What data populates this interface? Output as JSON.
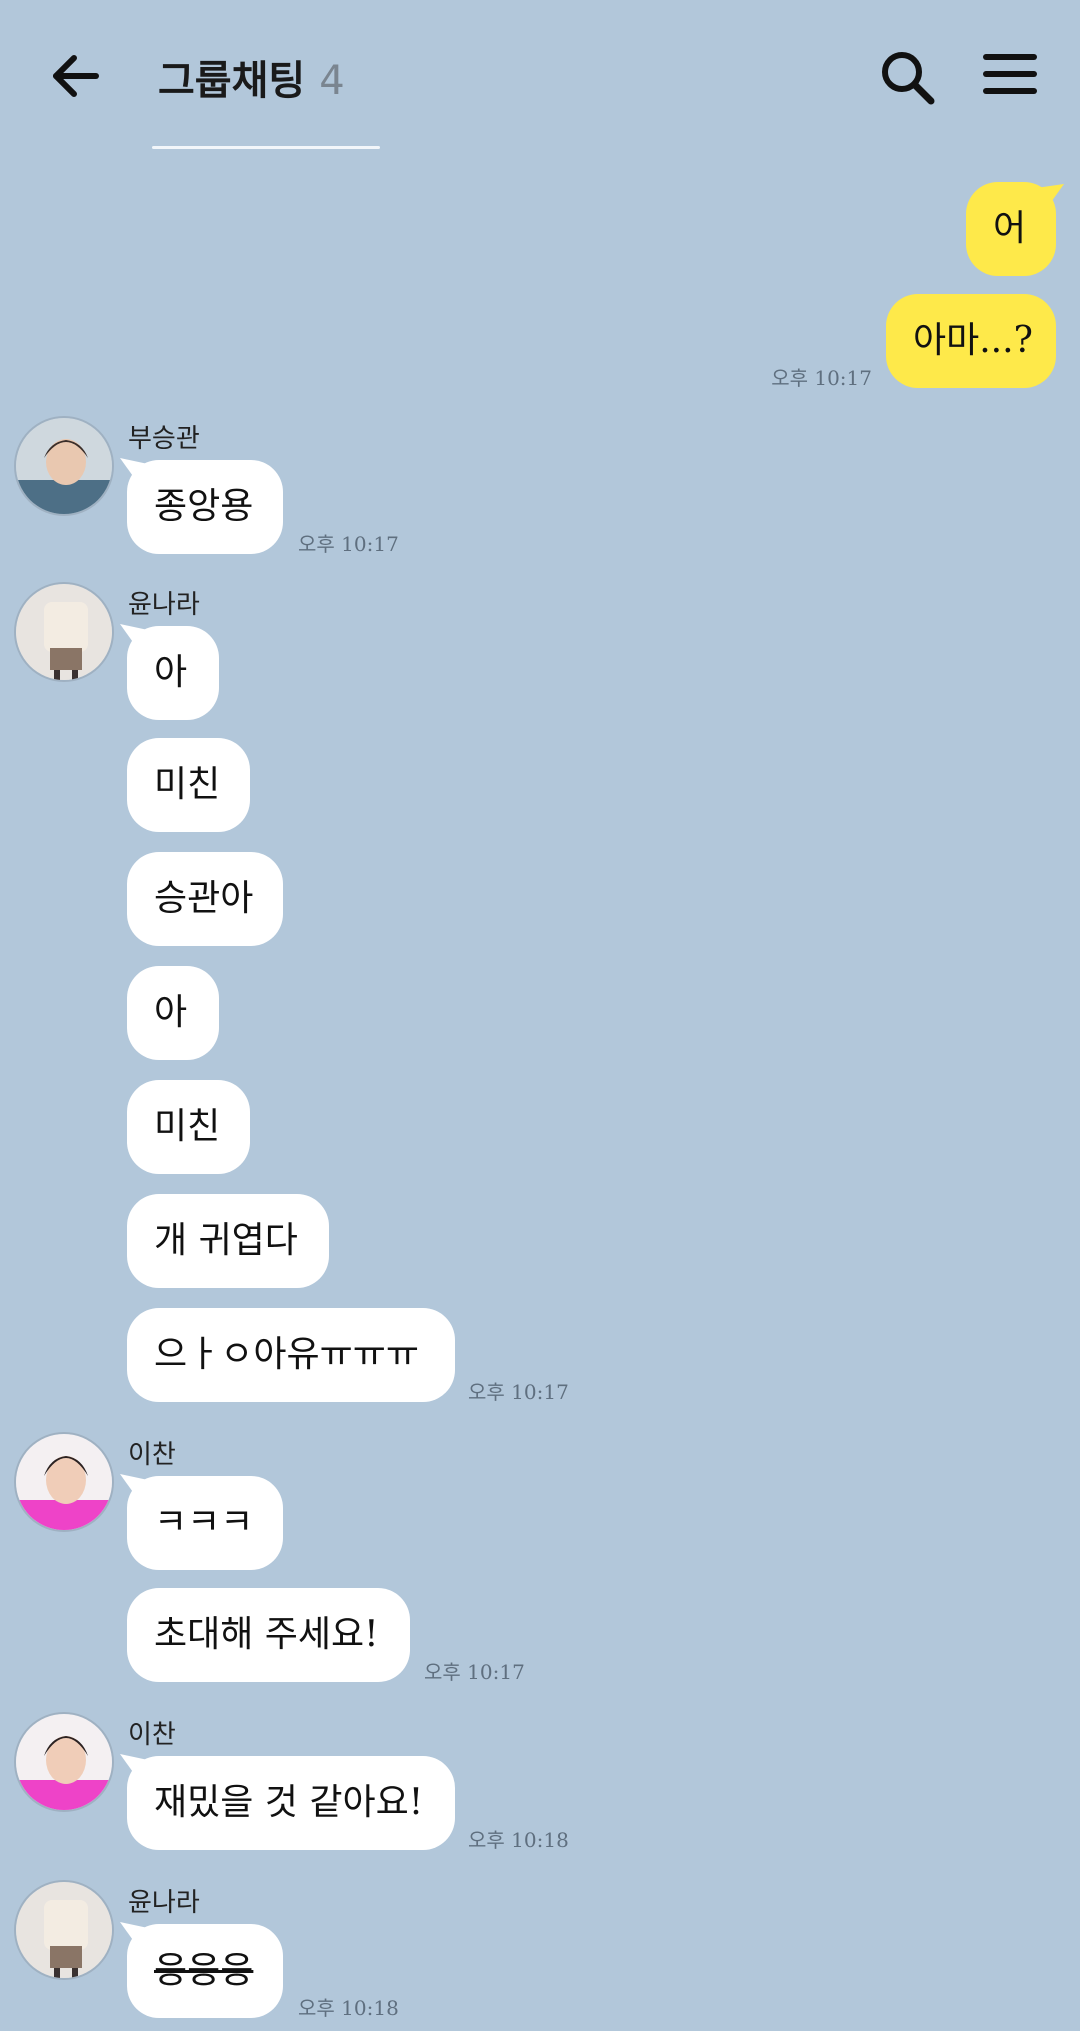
{
  "header": {
    "title": "그룹채팅",
    "member_count": "4",
    "back_icon": "back-arrow-icon",
    "search_icon": "search-icon",
    "menu_icon": "hamburger-menu-icon"
  },
  "colors": {
    "background": "#b2c7da",
    "incoming_bubble": "#ffffff",
    "outgoing_bubble": "#fee94a",
    "timestamp": "#5f6f7f"
  },
  "outgoing": [
    {
      "text": "어"
    },
    {
      "text": "아마...?",
      "time": "오후 10:17"
    }
  ],
  "groups": [
    {
      "sender": "부승관",
      "avatar": "avatar-boo-seungkwan",
      "messages": [
        {
          "text": "종앙용",
          "time": "오후 10:17"
        }
      ]
    },
    {
      "sender": "윤나라",
      "avatar": "avatar-yoon-nara",
      "messages": [
        {
          "text": "아"
        },
        {
          "text": "미친"
        },
        {
          "text": "승관아"
        },
        {
          "text": "아"
        },
        {
          "text": "미친"
        },
        {
          "text": "개 귀엽다"
        },
        {
          "text": "으ㅏㅇ아유ㅠㅠㅠ",
          "time": "오후 10:17"
        }
      ]
    },
    {
      "sender": "이찬",
      "avatar": "avatar-lee-chan",
      "messages": [
        {
          "text": "ㅋㅋㅋ"
        },
        {
          "text": "초대해 주세요!",
          "time": "오후 10:17"
        }
      ]
    },
    {
      "sender": "이찬",
      "avatar": "avatar-lee-chan",
      "messages": [
        {
          "text": "재밌을 것 같아요!",
          "time": "오후 10:18"
        }
      ]
    },
    {
      "sender": "윤나라",
      "avatar": "avatar-yoon-nara",
      "messages": [
        {
          "text": "응응응",
          "time": "오후 10:18"
        }
      ]
    }
  ]
}
